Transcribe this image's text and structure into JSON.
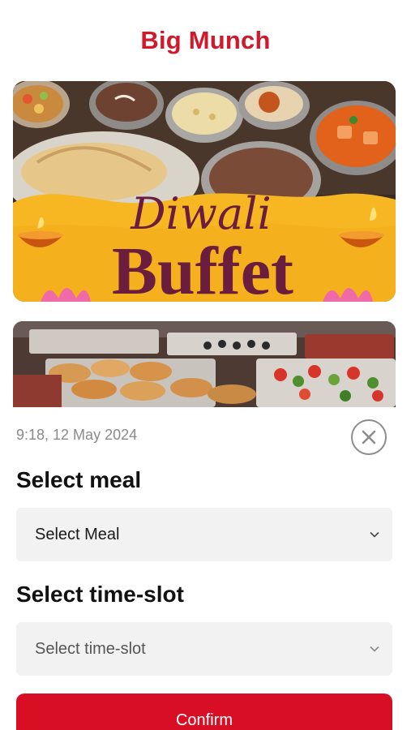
{
  "header": {
    "brand_name": "Big Munch"
  },
  "banner": {
    "title_script": "Diwali",
    "title_main": "Buffet"
  },
  "booking": {
    "timestamp": "9:18, 12 May 2024",
    "meal_section_title": "Select meal",
    "meal_select_value": "Select Meal",
    "timeslot_section_title": "Select time-slot",
    "timeslot_select_value": "Select time-slot",
    "confirm_label": "Confirm"
  },
  "icons": {
    "close": "close-icon",
    "chevron": "chevron-down-icon"
  },
  "colors": {
    "brand_red": "#d0192a",
    "button_red": "#d80f24",
    "banner_yellow": "#f6b722",
    "banner_plum": "#6b1d3e",
    "field_bg": "#f2f2f2"
  }
}
